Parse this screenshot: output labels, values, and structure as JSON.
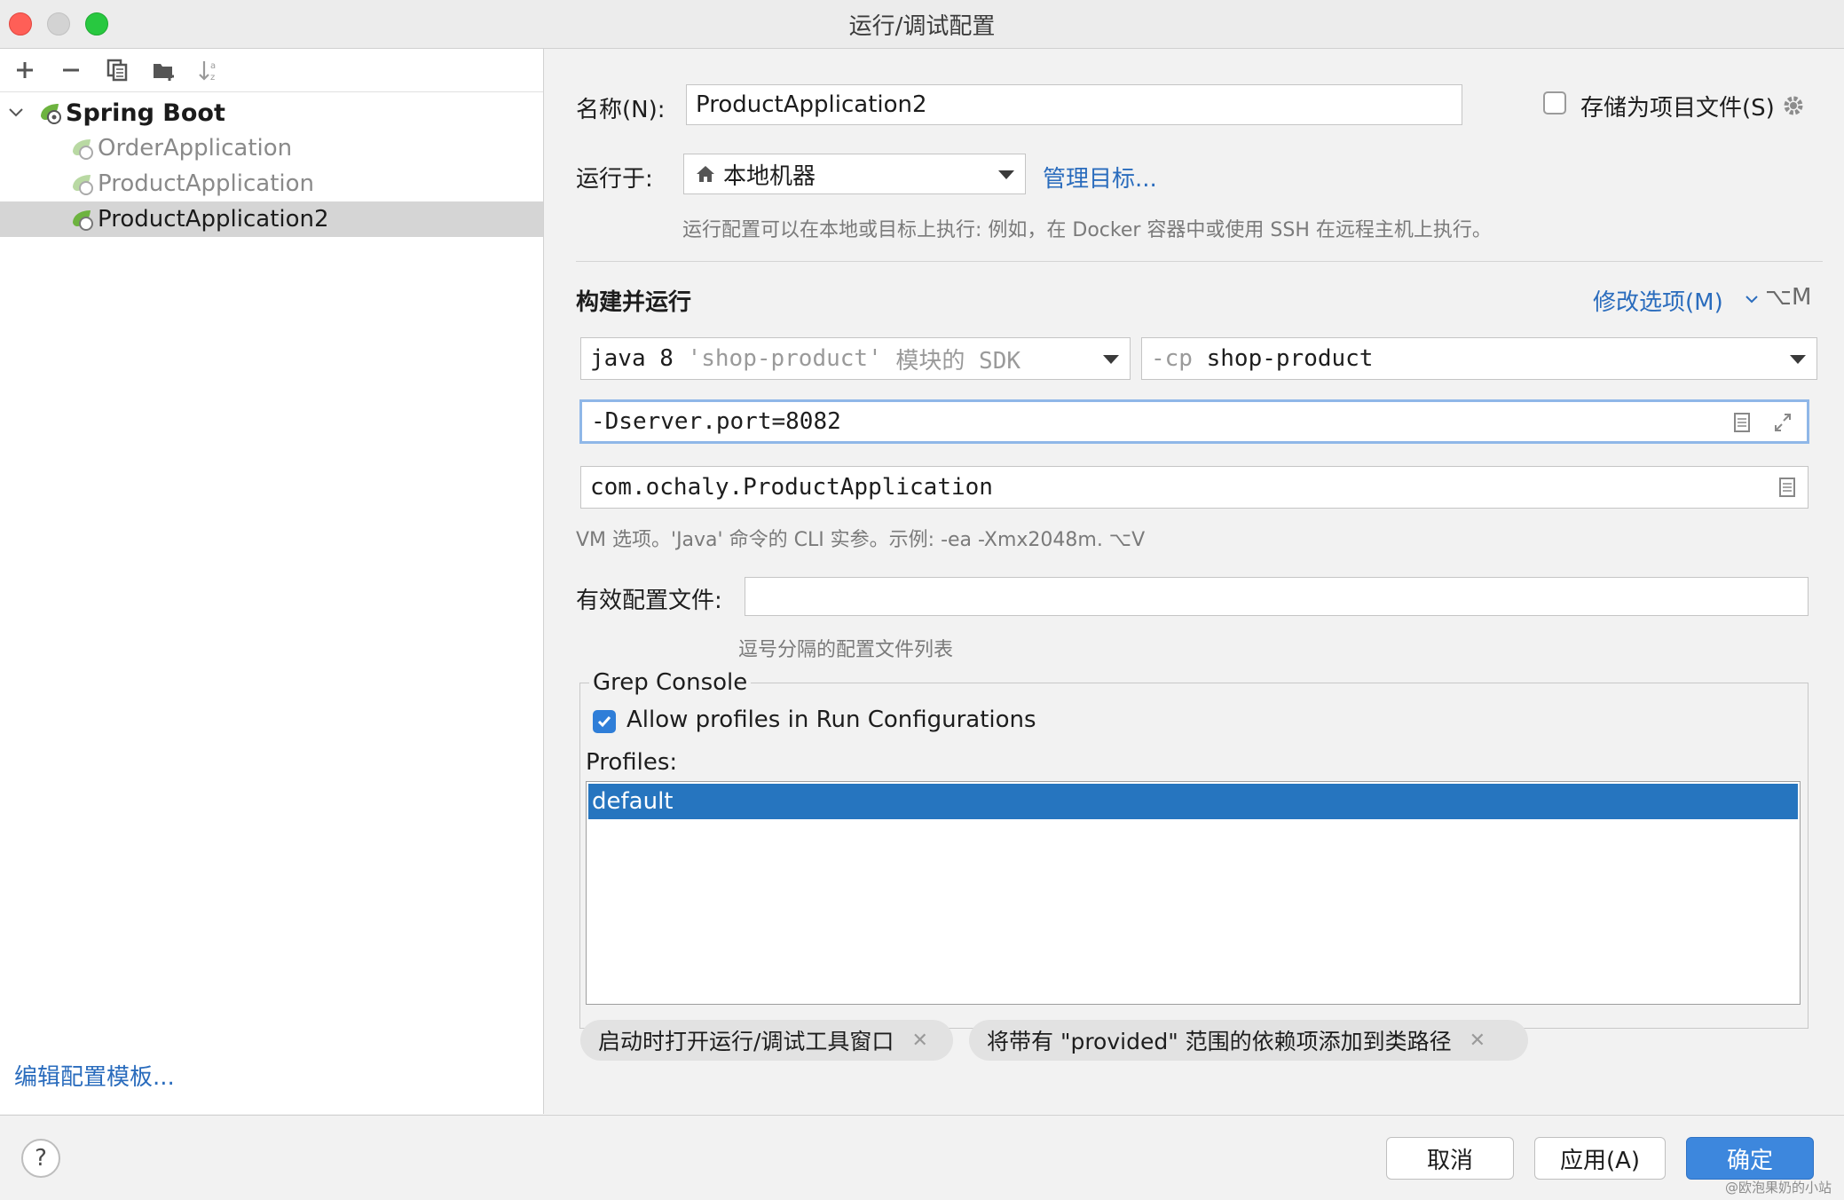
{
  "window": {
    "title": "运行/调试配置"
  },
  "toolbar": {
    "icons": [
      "plus-icon",
      "minus-icon",
      "copy-icon",
      "new-folder-icon",
      "sort-az-icon"
    ]
  },
  "tree": {
    "group": {
      "label": "Spring Boot",
      "icon": "spring-boot-icon"
    },
    "items": [
      {
        "label": "OrderApplication",
        "selected": false
      },
      {
        "label": "ProductApplication",
        "selected": false
      },
      {
        "label": "ProductApplication2",
        "selected": true
      }
    ]
  },
  "left_footer": {
    "edit_templates": "编辑配置模板..."
  },
  "form": {
    "name_label": "名称(N):",
    "name_value": "ProductApplication2",
    "store_label": "存储为项目文件(S)",
    "store_checked": false,
    "run_on_label": "运行于:",
    "run_on_value": "本地机器",
    "manage_targets": "管理目标...",
    "run_on_hint": "运行配置可以在本地或目标上执行: 例如，在 Docker 容器中或使用 SSH 在远程主机上执行。",
    "section_title": "构建并运行",
    "modify_options": "修改选项(M)",
    "modify_shortcut": "⌥M",
    "sdk_java": "java 8",
    "sdk_module": "'shop-product'",
    "sdk_suffix": "模块的 SDK",
    "cp_flag": "-cp",
    "cp_value": "shop-product",
    "vm_options": "-Dserver.port=8082",
    "main_class": "com.ochaly.ProductApplication",
    "vm_hint": "VM 选项。'Java' 命令的 CLI 实参。示例: -ea -Xmx2048m. ⌥V",
    "profiles_label": "有效配置文件:",
    "profiles_value": "",
    "profiles_hint": "逗号分隔的配置文件列表"
  },
  "grep_console": {
    "legend": "Grep Console",
    "allow_label": "Allow profiles in Run Configurations",
    "allow_checked": true,
    "profiles_label": "Profiles:",
    "profiles": [
      "default"
    ]
  },
  "chips": [
    {
      "label": "启动时打开运行/调试工具窗口"
    },
    {
      "label": "将带有 \"provided\" 范围的依赖项添加到类路径"
    }
  ],
  "buttons": {
    "help": "?",
    "cancel": "取消",
    "apply": "应用(A)",
    "ok": "确定"
  },
  "watermark": "@欧泡果奶的小站",
  "colors": {
    "accent": "#2f7ed8",
    "link": "#2a6cbd",
    "selection": "#2675bf"
  }
}
